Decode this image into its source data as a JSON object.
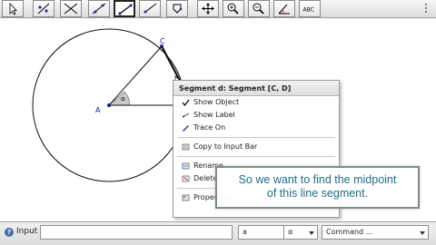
{
  "toolbar": {
    "tools": [
      {
        "name": "move-tool-icon",
        "active": false
      },
      {
        "name": "point-tool-icon",
        "active": false
      },
      {
        "name": "perpendicular-tool-icon",
        "active": false
      },
      {
        "name": "line-tool-icon",
        "active": false
      },
      {
        "name": "segment-tool-icon",
        "active": true
      },
      {
        "name": "ray-tool-icon",
        "active": false
      },
      {
        "name": "polygon-tool-icon",
        "active": false
      },
      {
        "name": "circle-tool-icon",
        "active": false
      },
      {
        "name": "move-view-tool-icon",
        "active": false
      },
      {
        "name": "zoom-in-tool-icon",
        "active": false
      },
      {
        "name": "zoom-out-tool-icon",
        "active": false
      },
      {
        "name": "angle-tool-icon",
        "active": false
      },
      {
        "name": "text-tool-icon",
        "active": false,
        "label": "ABC"
      }
    ]
  },
  "canvas": {
    "point_a_label": "A",
    "point_c_label": "C",
    "angle_label": "α"
  },
  "context_menu": {
    "title": "Segment d: Segment [C, D]",
    "items": [
      {
        "label": "Show Object",
        "icon": "checkmark-icon"
      },
      {
        "label": "Show Label",
        "icon": "label-icon"
      },
      {
        "label": "Trace On",
        "icon": "trace-icon"
      },
      {
        "label": "Copy to Input Bar",
        "icon": "copy-icon"
      },
      {
        "label": "Rename",
        "icon": "rename-icon"
      },
      {
        "label": "Delete",
        "icon": "delete-icon"
      },
      {
        "label": "Properties ...",
        "icon": "properties-icon"
      }
    ]
  },
  "caption": {
    "line1": "So we want to find the midpoint",
    "line2": "of this line segment."
  },
  "input_bar": {
    "label": "Input",
    "symbol_dropdown": "a",
    "greek_dropdown": "α",
    "command_dropdown": "Command ..."
  },
  "colors": {
    "point": "#1a1a8c",
    "caption_text": "#1d6f8a"
  }
}
